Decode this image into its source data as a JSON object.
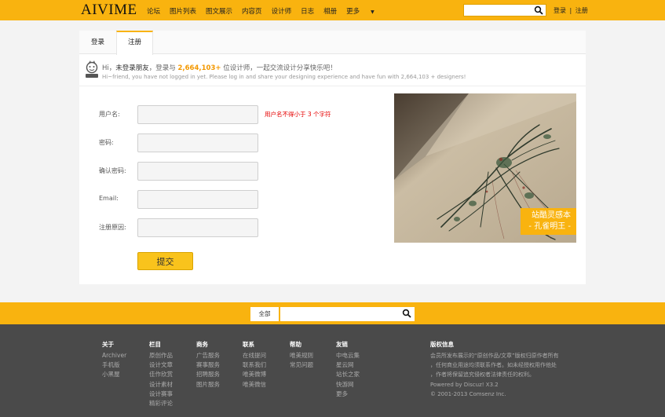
{
  "header": {
    "logo": "AIVIME",
    "nav": [
      "论坛",
      "图片列表",
      "图文展示",
      "内容页",
      "设计师",
      "日志",
      "相册",
      "更多"
    ],
    "search": {
      "placeholder": ""
    },
    "login": "登录",
    "separator": "|",
    "register": "注册"
  },
  "tabs": {
    "login": "登录",
    "register": "注册"
  },
  "notice": {
    "greet": "Hi，",
    "not_logged": "未登录朋友",
    "mid": "，登录与",
    "count": "2,664,103+",
    "tail": "位设计师，一起交流设计分享快乐吧！",
    "english": "Hi~friend, you have not logged in yet. Please log in and share your designing experience and have fun with 2,664,103 + designers!"
  },
  "form": {
    "username_label": "用户名:",
    "username_value": "",
    "username_error": "用户名不得小于 3 个字符",
    "password_label": "密码:",
    "password_value": "",
    "confirm_label": "确认密码:",
    "confirm_value": "",
    "email_label": "Email:",
    "email_value": "",
    "reason_label": "注册原因:",
    "reason_value": "",
    "submit": "提交"
  },
  "promo": {
    "line1": "站酷灵感本",
    "line2": "- 孔雀明王 -"
  },
  "footer_search": {
    "scope": "全部",
    "placeholder": ""
  },
  "footer": {
    "columns": [
      {
        "title": "关于",
        "items": [
          "Archiver",
          "手机版",
          "小黑屋"
        ]
      },
      {
        "title": "栏目",
        "items": [
          "原创作品",
          "设计文章",
          "佳作欣赏",
          "设计素材",
          "设计赛事",
          "精彩评论"
        ]
      },
      {
        "title": "商务",
        "items": [
          "广告服务",
          "赛事服务",
          "招聘服务",
          "图片服务"
        ]
      },
      {
        "title": "联系",
        "items": [
          "在线提问",
          "联系我们",
          "唯美微博",
          "唯美微信"
        ]
      },
      {
        "title": "帮助",
        "items": [
          "唯美规则",
          "常见问题"
        ]
      },
      {
        "title": "友链",
        "items": [
          "中电云集",
          "星云网",
          "站长之家",
          "快游网",
          "更多"
        ]
      }
    ],
    "copyright": {
      "title": "版权信息",
      "lines": [
        "会员所发布展示的“原创作品/文章”版权归原作者所有",
        "，任何商业用途均须联系作者。如未经授权用作他处",
        "，作者将保留追究侵权者法律责任的权利。",
        "Powered by Discuz! X3.2",
        "© 2001-2013 Comsenz Inc."
      ]
    }
  },
  "colors": {
    "brand_yellow": "#f9b30f",
    "error_red": "#e60000",
    "count_orange": "#f39800",
    "footer_bg": "#4a4a4a"
  }
}
